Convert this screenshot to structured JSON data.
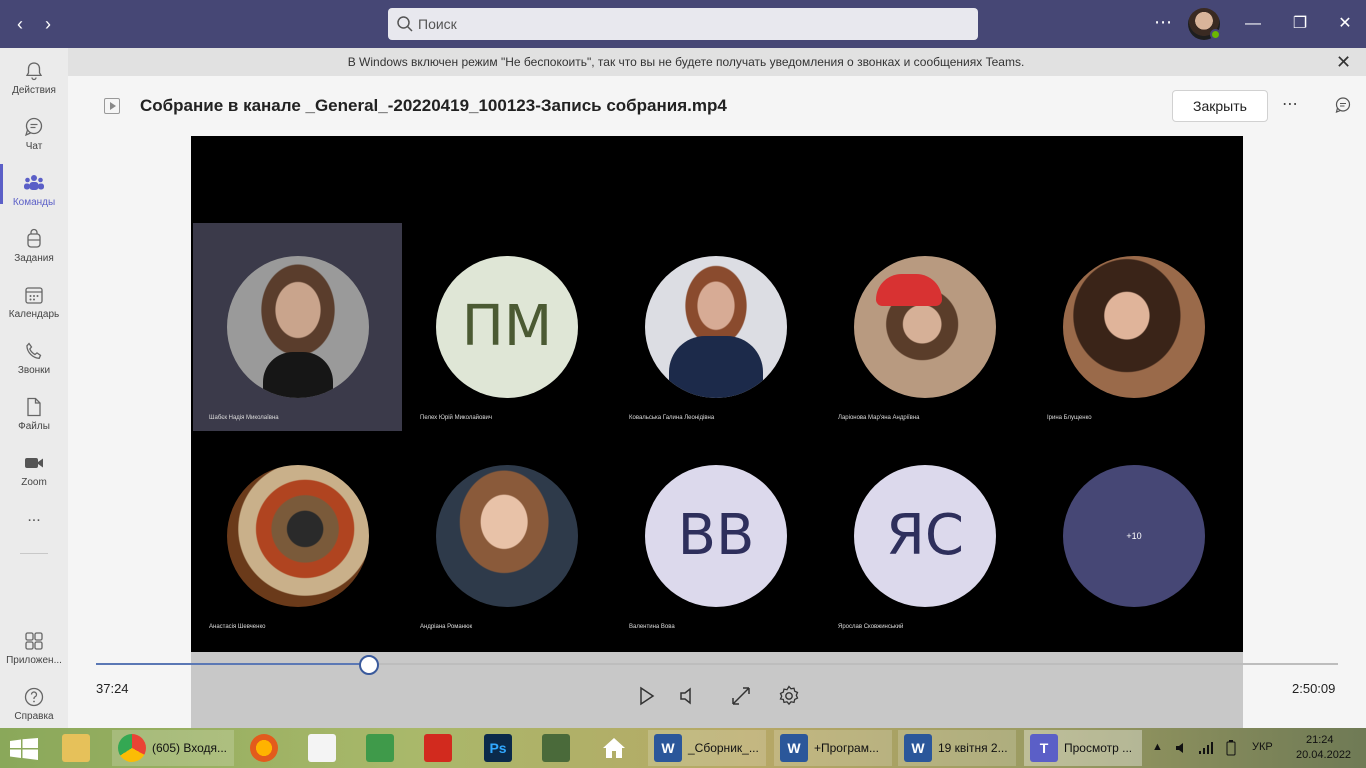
{
  "titlebar": {
    "search_placeholder": "Поиск",
    "more": "⋯"
  },
  "rail": {
    "items": [
      {
        "label": "Действия",
        "icon": "bell-icon"
      },
      {
        "label": "Чат",
        "icon": "chat-icon"
      },
      {
        "label": "Команды",
        "icon": "teams-icon"
      },
      {
        "label": "Задания",
        "icon": "assignments-icon"
      },
      {
        "label": "Календарь",
        "icon": "calendar-icon"
      },
      {
        "label": "Звонки",
        "icon": "phone-icon"
      },
      {
        "label": "Файлы",
        "icon": "file-icon"
      },
      {
        "label": "Zoom",
        "icon": "video-icon"
      },
      {
        "label": "...",
        "icon": "more-icon"
      },
      {
        "label": "Приложен...",
        "icon": "apps-icon"
      },
      {
        "label": "Справка",
        "icon": "help-icon"
      }
    ]
  },
  "notification": {
    "text": "В Windows включен режим \"Не беспокоить\", так что вы не будете получать уведомления о звонках и сообщениях Teams."
  },
  "header": {
    "title": "Собрание в канале _General_-20220419_100123-Запись собрания.mp4",
    "close_label": "Закрыть",
    "more": "⋯"
  },
  "participants": [
    {
      "name": "Шабєк Надія Миколаївна",
      "initials": "",
      "type": "photo"
    },
    {
      "name": "Пелех Юрій Миколайович",
      "initials": "ПМ",
      "type": "initials"
    },
    {
      "name": "Ковальська Галина Леонідівна",
      "initials": "",
      "type": "photo"
    },
    {
      "name": "Ларіонова Мар'яна Андріївна",
      "initials": "",
      "type": "photo"
    },
    {
      "name": "Ірина Блущенко",
      "initials": "",
      "type": "photo"
    },
    {
      "name": "Анастасія Шевченко",
      "initials": "",
      "type": "photo"
    },
    {
      "name": "Андріана Романюк",
      "initials": "",
      "type": "photo"
    },
    {
      "name": "Валентина Вова",
      "initials": "ВВ",
      "type": "initials"
    },
    {
      "name": "Ярослав Сковжинський",
      "initials": "ЯС",
      "type": "initials"
    },
    {
      "name": "",
      "initials": "+10",
      "type": "overflow"
    }
  ],
  "player": {
    "current_time": "37:24",
    "total_time": "2:50:09",
    "progress_fraction": 0.22
  },
  "taskbar": {
    "apps": [
      {
        "label": "(605) Входя...",
        "icon": "chrome-icon"
      },
      {
        "label": "_Сборник_...",
        "icon": "word-icon"
      },
      {
        "label": "+Програм...",
        "icon": "word-icon"
      },
      {
        "label": "19 квітня 2...",
        "icon": "word-icon"
      },
      {
        "label": "Просмотр ...",
        "icon": "teams-icon"
      }
    ],
    "lang": "УКР",
    "time": "21:24",
    "date": "20.04.2022"
  },
  "colors": {
    "titlebar": "#464775",
    "accent": "#5b5fc7",
    "initials_circle": "#dcd9ec",
    "overflow_circle": "#464775"
  }
}
